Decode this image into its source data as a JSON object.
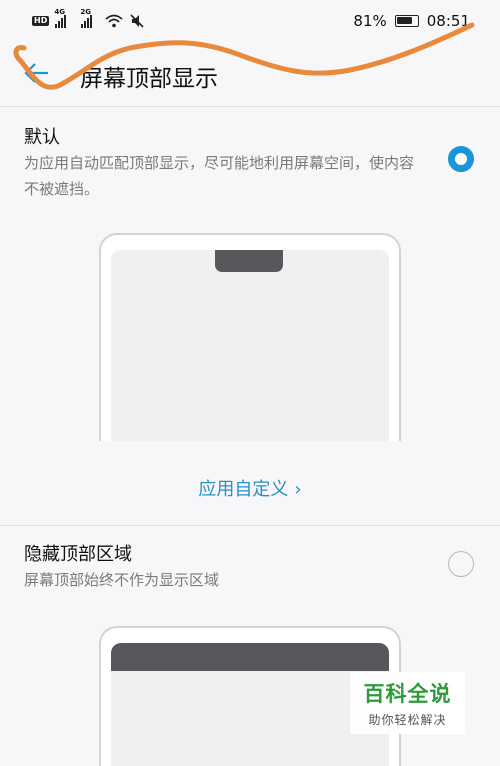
{
  "status_bar": {
    "hd": "HD",
    "sim1_network": "4G",
    "sim2_network": "2G",
    "battery": "81%",
    "time": "08:51"
  },
  "header": {
    "title": "屏幕顶部显示"
  },
  "options": [
    {
      "title": "默认",
      "description": "为应用自动匹配顶部显示，尽可能地利用屏幕空间，使内容不被遮挡。",
      "selected": true
    },
    {
      "title": "隐藏顶部区域",
      "description": "屏幕顶部始终不作为显示区域",
      "selected": false
    }
  ],
  "link": {
    "label": "应用自定义",
    "chevron": "›"
  },
  "watermark": {
    "title": "百科全说",
    "subtitle": "助你轻松解决"
  },
  "colors": {
    "accent": "#1a95d6",
    "scribble": "#e8893b",
    "link": "#2a8fc4",
    "watermark_green": "#2e9a3c"
  },
  "icons": [
    "back-arrow-icon",
    "wifi-icon",
    "mute-icon",
    "battery-icon",
    "signal-icon",
    "chevron-right-icon"
  ]
}
